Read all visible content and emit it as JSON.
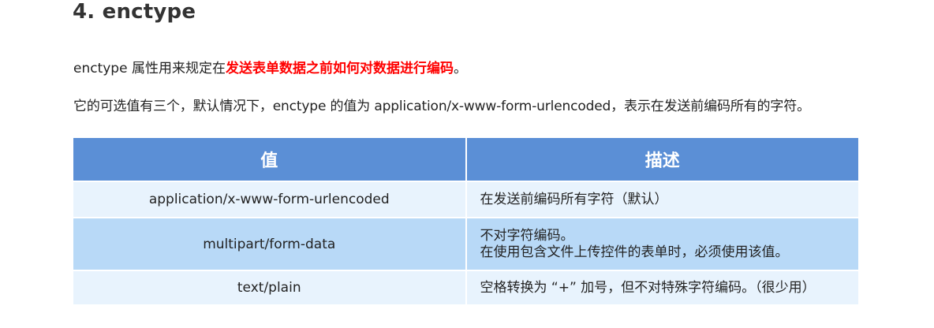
{
  "heading": "4. enctype",
  "para1": {
    "prefix": "enctype 属性用来规定在",
    "highlight": "发送表单数据之前如何对数据进行编码",
    "suffix": "。"
  },
  "para2": "它的可选值有三个，默认情况下，enctype 的值为 application/x-www-form-urlencoded，表示在发送前编码所有的字符。",
  "table": {
    "headers": [
      "值",
      "描述"
    ],
    "rows": [
      {
        "value": "application/x-www-form-urlencoded",
        "desc1": "在发送前编码所有字符（默认）",
        "desc2": ""
      },
      {
        "value": "multipart/form-data",
        "desc1": "不对字符编码。",
        "desc2": "在使用包含文件上传控件的表单时，必须使用该值。"
      },
      {
        "value": "text/plain",
        "desc1": "空格转换为 “+” 加号，但不对特殊字符编码。（很少用）",
        "desc2": ""
      }
    ]
  },
  "colors": {
    "header_bg": "#5b8fd6",
    "row_light": "#e8f3fd",
    "row_dark": "#b8d9f7",
    "highlight": "#ff0000"
  }
}
